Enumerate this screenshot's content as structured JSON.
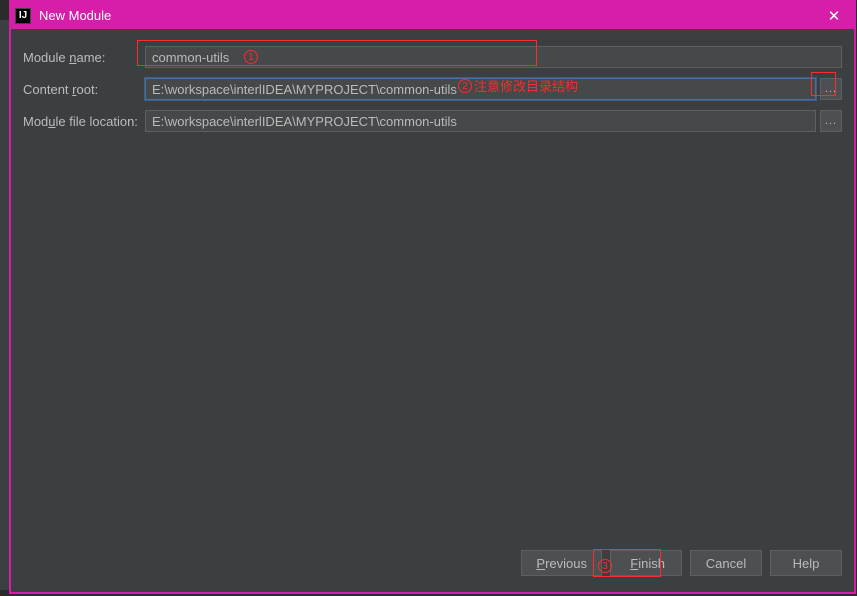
{
  "titlebar": {
    "app_icon": "IJ",
    "title": "New Module",
    "close": "✕"
  },
  "form": {
    "module_name": {
      "label_pre": "Module ",
      "label_mn": "n",
      "label_post": "ame:",
      "value": "common-utils"
    },
    "content_root": {
      "label_pre": "Content ",
      "label_mn": "r",
      "label_post": "oot:",
      "value": "E:\\workspace\\interlIDEA\\MYPROJECT\\common-utils",
      "browse": "..."
    },
    "module_file_location": {
      "label_pre": "Mod",
      "label_mn": "u",
      "label_post": "le file location:",
      "value": "E:\\workspace\\interlIDEA\\MYPROJECT\\common-utils",
      "browse": "..."
    }
  },
  "annotations": {
    "n1": "1",
    "n2": "2",
    "n2_text": "注意修改目录结构",
    "n3": "3"
  },
  "footer": {
    "previous_mn": "P",
    "previous_rest": "revious",
    "finish_mn": "F",
    "finish_rest": "inish",
    "cancel": "Cancel",
    "help": "Help"
  }
}
